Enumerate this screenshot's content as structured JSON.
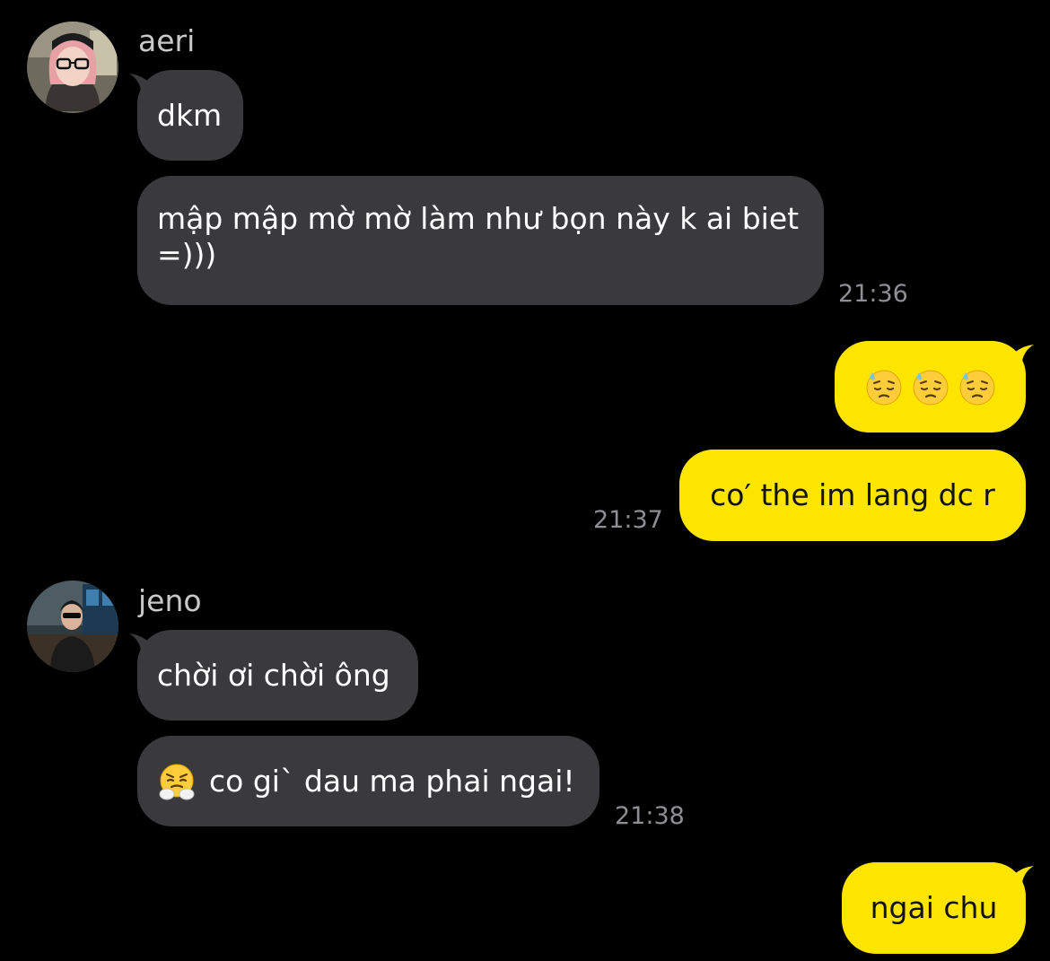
{
  "colors": {
    "background": "#000000",
    "incoming_bubble": "#3a3a3c",
    "outgoing_bubble": "#fee500",
    "timestamp": "#8e8e93",
    "sender_name": "#c9c9c9"
  },
  "messages": {
    "group1": {
      "sender": "aeri",
      "avatar_icon": "avatar-aeri",
      "bubble1": "dkm",
      "bubble2_line1": "mập mập mờ mờ làm như bọn này k ai biet",
      "bubble2_line2": "=)))",
      "time": "21:36"
    },
    "group2": {
      "emojis": [
        "downcast-sweat-face-emoji",
        "downcast-sweat-face-emoji",
        "downcast-sweat-face-emoji"
      ],
      "bubble2": "co′ the im lang dc r",
      "time": "21:37"
    },
    "group3": {
      "sender": "jeno",
      "avatar_icon": "avatar-jeno",
      "bubble1": "chời ơi chời ông",
      "bubble2_emoji": "steam-from-nose-face-emoji",
      "bubble2": "co gi` dau ma phai ngai!",
      "time": "21:38"
    },
    "group4": {
      "bubble1": "ngai chu"
    }
  }
}
